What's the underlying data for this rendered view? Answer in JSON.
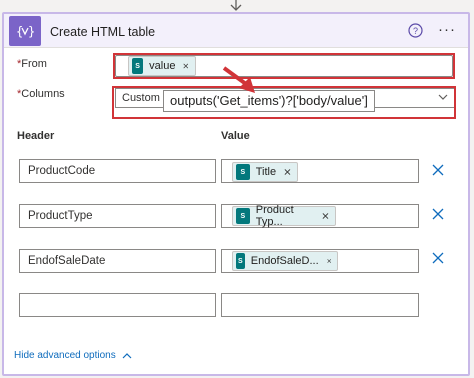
{
  "action": {
    "title": "Create HTML table",
    "more_label": "···"
  },
  "from": {
    "label": "From",
    "required_mark": "*",
    "token_label": "value",
    "token_icon_text": "S"
  },
  "columns": {
    "label": "Columns",
    "required_mark": "*",
    "selected_value": "Custom",
    "expression_tooltip": "outputs('Get_items')?['body/value']"
  },
  "table": {
    "header_col_label": "Header",
    "value_col_label": "Value",
    "rows": [
      {
        "header": "ProductCode",
        "value_token": "Title"
      },
      {
        "header": "ProductType",
        "value_token": "Product Typ..."
      },
      {
        "header": "EndofSaleDate",
        "value_token": "EndofSaleD..."
      },
      {
        "header": "",
        "value_token": ""
      }
    ]
  },
  "advanced_link": "Hide advanced options",
  "colors": {
    "action_accent": "#7b64c8",
    "highlight_red": "#d13438",
    "token_icon": "#03787c",
    "link_blue": "#0f6cbd"
  }
}
